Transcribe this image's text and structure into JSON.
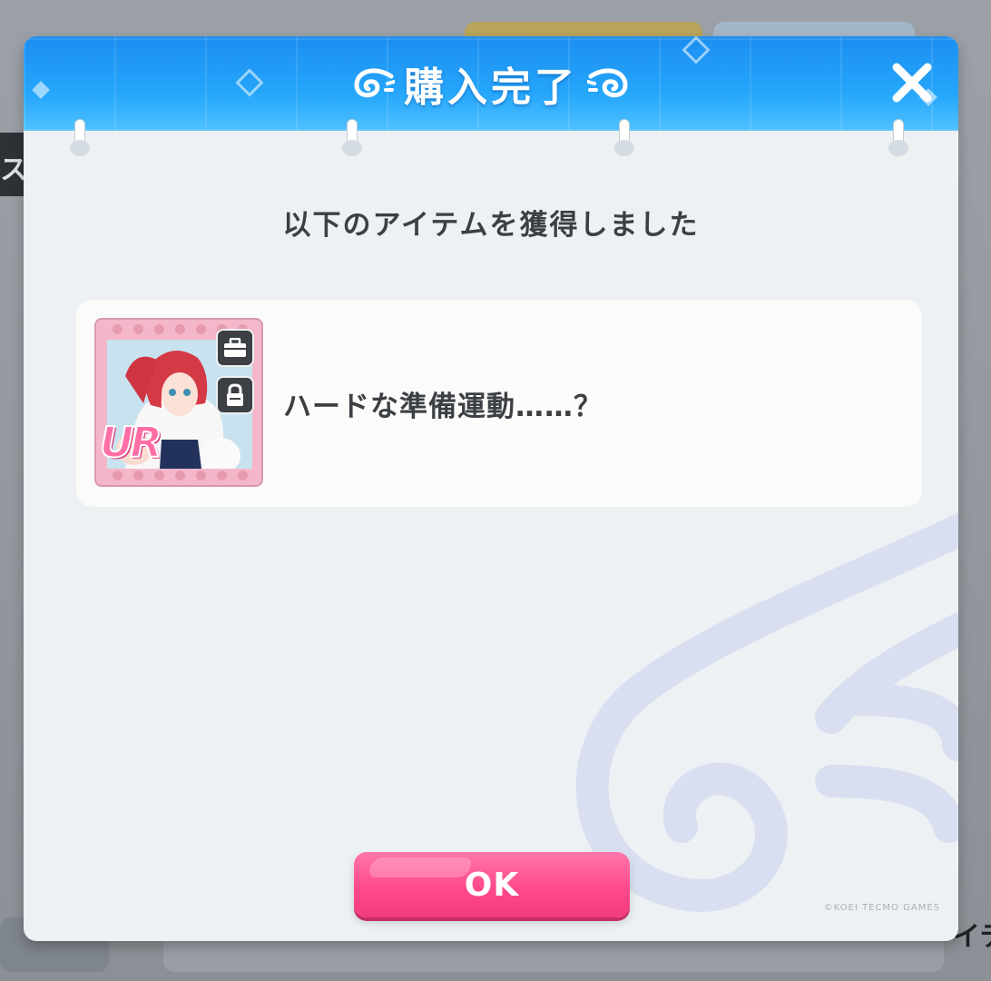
{
  "dialog": {
    "title": "購入完了",
    "message": "以下のアイテムを獲得しました",
    "ok_label": "OK",
    "copyright": "©KOEI TECMO GAMES"
  },
  "item": {
    "name": "ハードな準備運動……？",
    "rarity": "UR"
  },
  "background": {
    "left_tab_text": "ス",
    "right_text": "イテ"
  },
  "colors": {
    "header_blue": "#25a6fb",
    "ok_pink": "#ff4a8d",
    "panel": "#edf1f4"
  },
  "icons": [
    "wing-left-icon",
    "wing-right-icon",
    "close-icon",
    "bag-icon",
    "lock-icon",
    "wing-watermark-icon"
  ]
}
